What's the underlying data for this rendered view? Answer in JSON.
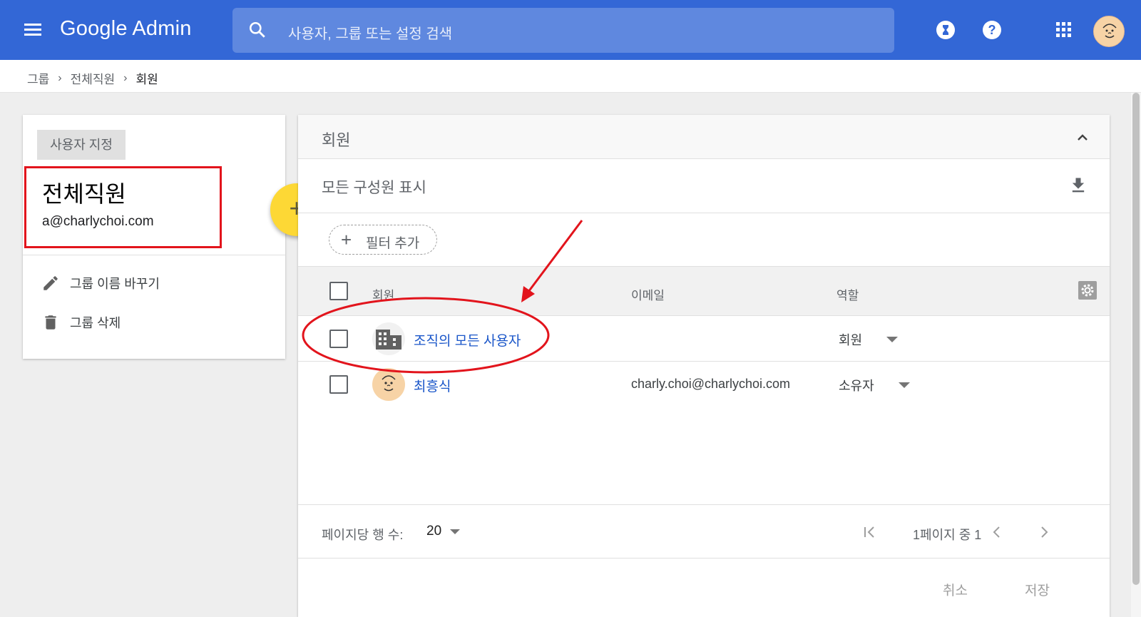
{
  "topbar": {
    "brand": "Google Admin",
    "search_placeholder": "사용자, 그룹 또는 설정 검색",
    "bg_color": "#3367d6"
  },
  "breadcrumb": [
    "그룹",
    "전체직원",
    "회원"
  ],
  "group": {
    "chip": "사용자 지정",
    "name": "전체직원",
    "email": "a@charlychoi.com",
    "actions": [
      "그룹 이름 바꾸기",
      "그룹 삭제"
    ]
  },
  "fab_label": "+",
  "members_panel": {
    "title": "회원",
    "show_all": "모든 구성원 표시",
    "add_filter": "필터 추가",
    "columns": [
      "회원",
      "이메일",
      "역할"
    ],
    "rows": [
      {
        "name": "조직의 모든 사용자",
        "email": "",
        "role": "회원",
        "avatar": "building-icon"
      },
      {
        "name": "최흥식",
        "email": "charly.choi@charlychoi.com",
        "role": "소유자",
        "avatar": "person-avatar"
      }
    ],
    "rows_per_page_label": "페이지당 행 수:",
    "rows_per_page": "20",
    "page_info": "1페이지 중 1",
    "cancel": "취소",
    "save": "저장"
  },
  "annotation_color": "#e2141c"
}
